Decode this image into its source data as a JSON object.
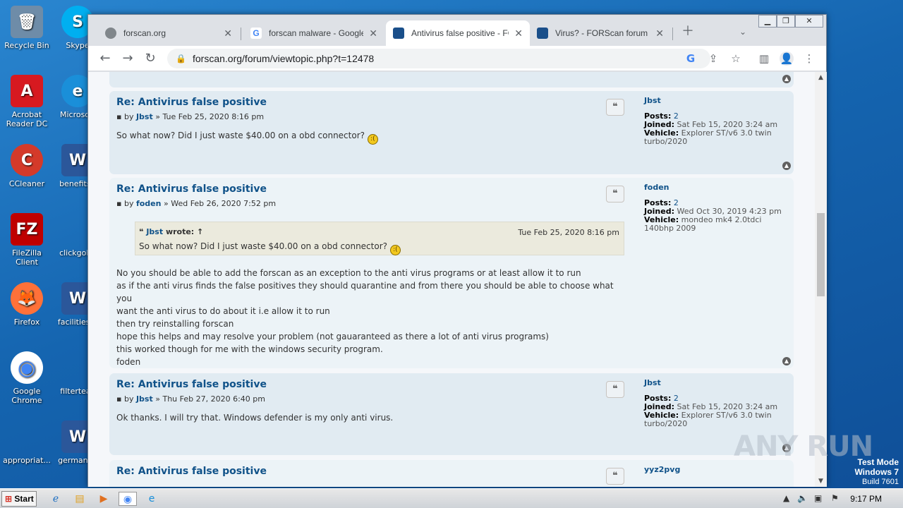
{
  "desktop": {
    "icons": [
      {
        "label": "Recycle Bin",
        "glyph": "🗑",
        "color": "#6e8ca8"
      },
      {
        "label": "Skype",
        "glyph": "S",
        "color": "#00aff0"
      },
      {
        "label": "Acrobat Reader DC",
        "glyph": "A",
        "color": "#d71920"
      },
      {
        "label": "Microsoft",
        "glyph": "e",
        "color": "#1a8fd9"
      },
      {
        "label": "CCleaner",
        "glyph": "C",
        "color": "#d43a2a"
      },
      {
        "label": "benefitstl",
        "glyph": "W",
        "color": "#2b579a"
      },
      {
        "label": "FileZilla Client",
        "glyph": "FZ",
        "color": "#bf0000"
      },
      {
        "label": "clickgold.",
        "glyph": "",
        "color": "#1565b0"
      },
      {
        "label": "Firefox",
        "glyph": "🦊",
        "color": "#ff7139"
      },
      {
        "label": "facilitiesfa",
        "glyph": "W",
        "color": "#2b579a"
      },
      {
        "label": "Google Chrome",
        "glyph": "◉",
        "color": "#34a853"
      },
      {
        "label": "filterteac",
        "glyph": "",
        "color": "#1565b0"
      },
      {
        "label": "appropriat...",
        "glyph": "",
        "color": "#1565b0"
      },
      {
        "label": "germanya",
        "glyph": "W",
        "color": "#2b579a"
      }
    ]
  },
  "browser": {
    "tabs": [
      {
        "label": "forscan.org",
        "icon": "globe-icon"
      },
      {
        "label": "forscan malware - Google Se",
        "icon": "google-icon"
      },
      {
        "label": "Antivirus false positive - FOR",
        "icon": "forscan-icon"
      },
      {
        "label": "Virus? - FORScan forum",
        "icon": "forscan-icon"
      }
    ],
    "url": "forscan.org/forum/viewtopic.php?t=12478"
  },
  "posts": [
    {
      "title": "Re: Antivirus false positive",
      "by": "by",
      "author": "Jbst",
      "date": "» Tue Feb 25, 2020 8:16 pm",
      "body": [
        "So what now? Did I just waste $40.00 on a obd connector?"
      ],
      "profile": {
        "name": "Jbst",
        "posts_label": "Posts:",
        "posts": "2",
        "joined_label": "Joined:",
        "joined": "Sat Feb 15, 2020 3:24 am",
        "vehicle_label": "Vehicle:",
        "vehicle": "Explorer ST/v6 3.0 twin turbo/2020"
      }
    },
    {
      "title": "Re: Antivirus false positive",
      "by": "by",
      "author": "foden",
      "date": "» Wed Feb 26, 2020 7:52 pm",
      "quote": {
        "author": "Jbst",
        "wrote": "wrote: ↑",
        "date": "Tue Feb 25, 2020 8:16 pm",
        "text": "So what now? Did I just waste $40.00 on a obd connector?"
      },
      "body": [
        "No you should be able to add the forscan as an exception to the anti virus programs or at least allow it to run",
        "as if the anti virus finds the false positives they should quarantine and from there you should be able to choose what you",
        "want the anti virus to do about it i.e allow it to run",
        "then try reinstalling forscan",
        "hope this helps and may resolve your problem (not gauaranteed as there a lot of anti virus programs)",
        "this worked though for me with the windows security program.",
        "foden"
      ],
      "profile": {
        "name": "foden",
        "posts_label": "Posts:",
        "posts": "2",
        "joined_label": "Joined:",
        "joined": "Wed Oct 30, 2019 4:23 pm",
        "vehicle_label": "Vehicle:",
        "vehicle": "mondeo mk4 2.0tdci 140bhp 2009"
      }
    },
    {
      "title": "Re: Antivirus false positive",
      "by": "by",
      "author": "Jbst",
      "date": "» Thu Feb 27, 2020 6:40 pm",
      "body": [
        "Ok thanks. I will try that. Windows defender is my only anti virus."
      ],
      "profile": {
        "name": "Jbst",
        "posts_label": "Posts:",
        "posts": "2",
        "joined_label": "Joined:",
        "joined": "Sat Feb 15, 2020 3:24 am",
        "vehicle_label": "Vehicle:",
        "vehicle": "Explorer ST/v6 3.0 twin turbo/2020"
      }
    },
    {
      "title": "Re: Antivirus false positive",
      "profile": {
        "name": "yyz2pvg"
      }
    }
  ],
  "watermark": "ANY RUN",
  "testmode": {
    "line1": "Test Mode",
    "line2": "Windows 7",
    "line3": "Build 7601"
  },
  "taskbar": {
    "start": "Start",
    "clock": "9:17 PM"
  }
}
